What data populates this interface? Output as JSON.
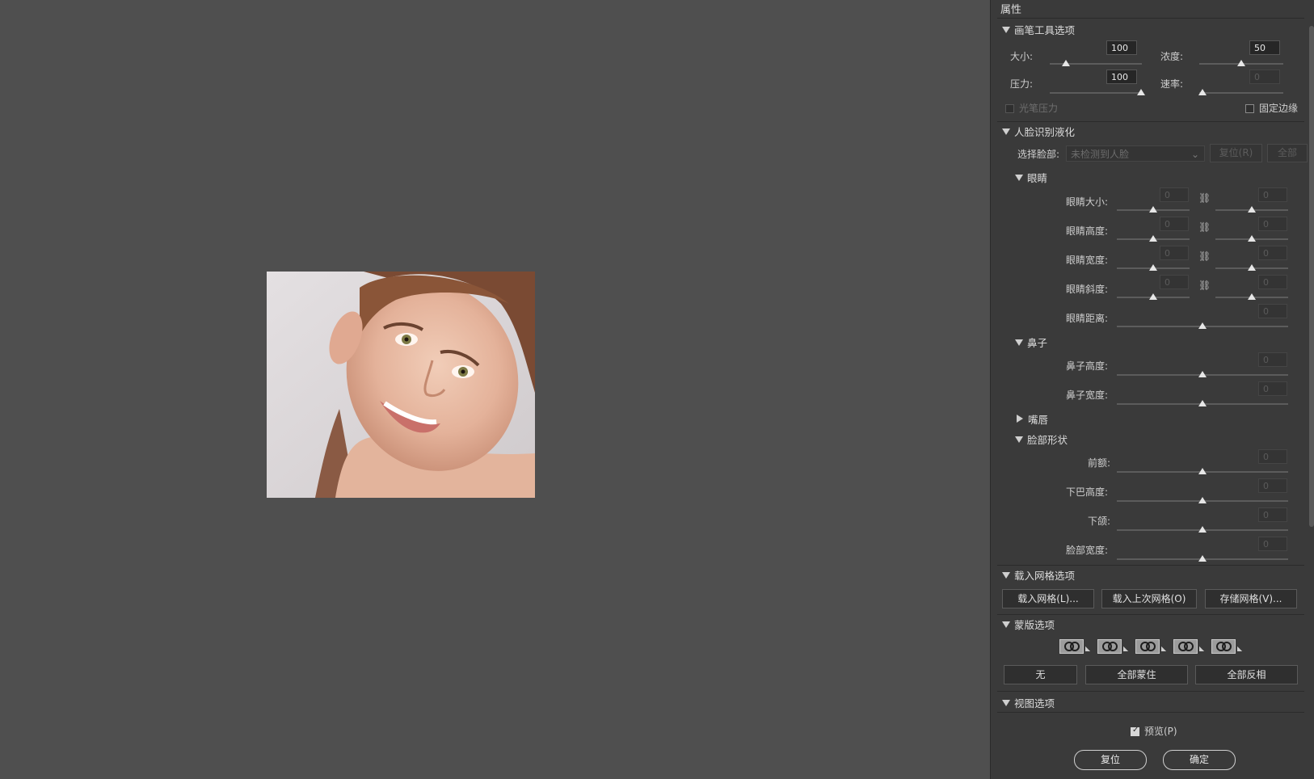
{
  "panel": {
    "title": "属性"
  },
  "brush": {
    "header": "画笔工具选项",
    "size_label": "大小:",
    "size_value": "100",
    "density_label": "浓度:",
    "density_value": "50",
    "pressure_label": "压力:",
    "pressure_value": "100",
    "rate_label": "速率:",
    "rate_value": "0",
    "stylus_label": "光笔压力",
    "pin_edges_label": "固定边缘"
  },
  "face": {
    "header": "人脸识别液化",
    "select_label": "选择脸部:",
    "select_value": "未检测到人脸",
    "reset_button": "复位(R)",
    "all_button": "全部",
    "eyes": {
      "header": "眼睛",
      "rows": [
        {
          "label": "眼睛大小:",
          "left": "0",
          "right": "0"
        },
        {
          "label": "眼睛高度:",
          "left": "0",
          "right": "0"
        },
        {
          "label": "眼睛宽度:",
          "left": "0",
          "right": "0"
        },
        {
          "label": "眼睛斜度:",
          "left": "0",
          "right": "0"
        }
      ],
      "distance_label": "眼睛距离:",
      "distance_value": "0"
    },
    "nose": {
      "header": "鼻子",
      "height_label": "鼻子高度:",
      "height_value": "0",
      "width_label": "鼻子宽度:",
      "width_value": "0"
    },
    "mouth": {
      "header": "嘴唇"
    },
    "shape": {
      "header": "脸部形状",
      "forehead_label": "前额:",
      "forehead_value": "0",
      "chin_label": "下巴高度:",
      "chin_value": "0",
      "jaw_label": "下颌:",
      "jaw_value": "0",
      "width_label": "脸部宽度:",
      "width_value": "0"
    }
  },
  "mesh": {
    "header": "载入网格选项",
    "load_button": "载入网格(L)...",
    "load_last_button": "载入上次网格(O)",
    "save_button": "存储网格(V)..."
  },
  "mask": {
    "header": "蒙版选项",
    "none_button": "无",
    "mask_all_button": "全部蒙住",
    "invert_all_button": "全部反相"
  },
  "view": {
    "header": "视图选项"
  },
  "footer": {
    "preview_label": "预览(P)",
    "reset_button": "复位",
    "ok_button": "确定"
  },
  "icons": {
    "chain": "chain-link-icon",
    "mask": "mask-mode-icon"
  }
}
